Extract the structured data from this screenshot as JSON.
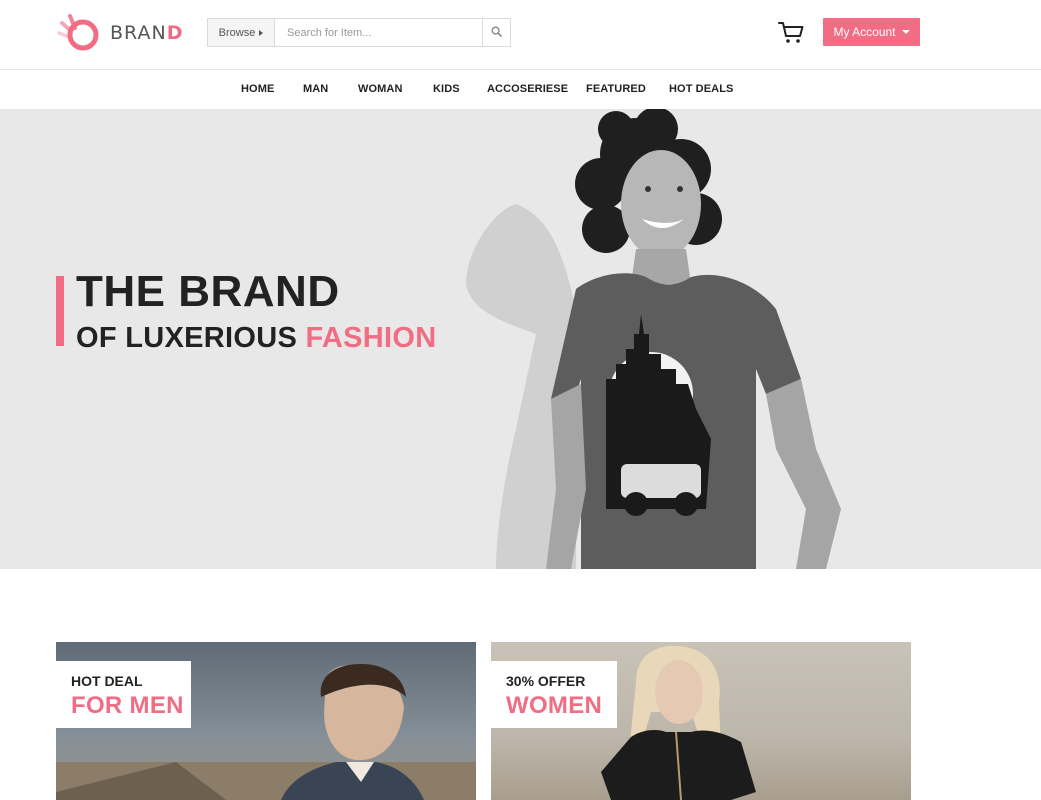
{
  "brand": {
    "name_main": "BRAN",
    "name_accent": "D"
  },
  "search": {
    "browse_label": "Browse",
    "placeholder": "Search for Item..."
  },
  "account": {
    "label": "My Account"
  },
  "icons": {
    "logo": "brand-b-logo-icon",
    "browse_caret": "caret-right-icon",
    "search": "search-icon",
    "cart": "cart-icon",
    "account_caret": "caret-down-icon"
  },
  "nav": {
    "items": [
      {
        "label": "HOME"
      },
      {
        "label": "MAN"
      },
      {
        "label": "WOMAN"
      },
      {
        "label": "KIDS"
      },
      {
        "label": "ACCOSERIESE"
      },
      {
        "label": "FEATURED"
      },
      {
        "label": "HOT DEALS"
      }
    ]
  },
  "hero": {
    "title": "THE BRAND",
    "subtitle_prefix": "OF LUXERIOUS ",
    "subtitle_accent": "FASHION",
    "image_alt": "Smiling man with curly hair wearing a printed t-shirt"
  },
  "promos": [
    {
      "kicker": "HOT DEAL",
      "heading": "FOR MEN"
    },
    {
      "kicker": "30% OFFER",
      "heading": "WOMEN"
    }
  ],
  "colors": {
    "accent": "#f06d84",
    "hero_bg": "#e8e8e8",
    "text": "#222222"
  }
}
